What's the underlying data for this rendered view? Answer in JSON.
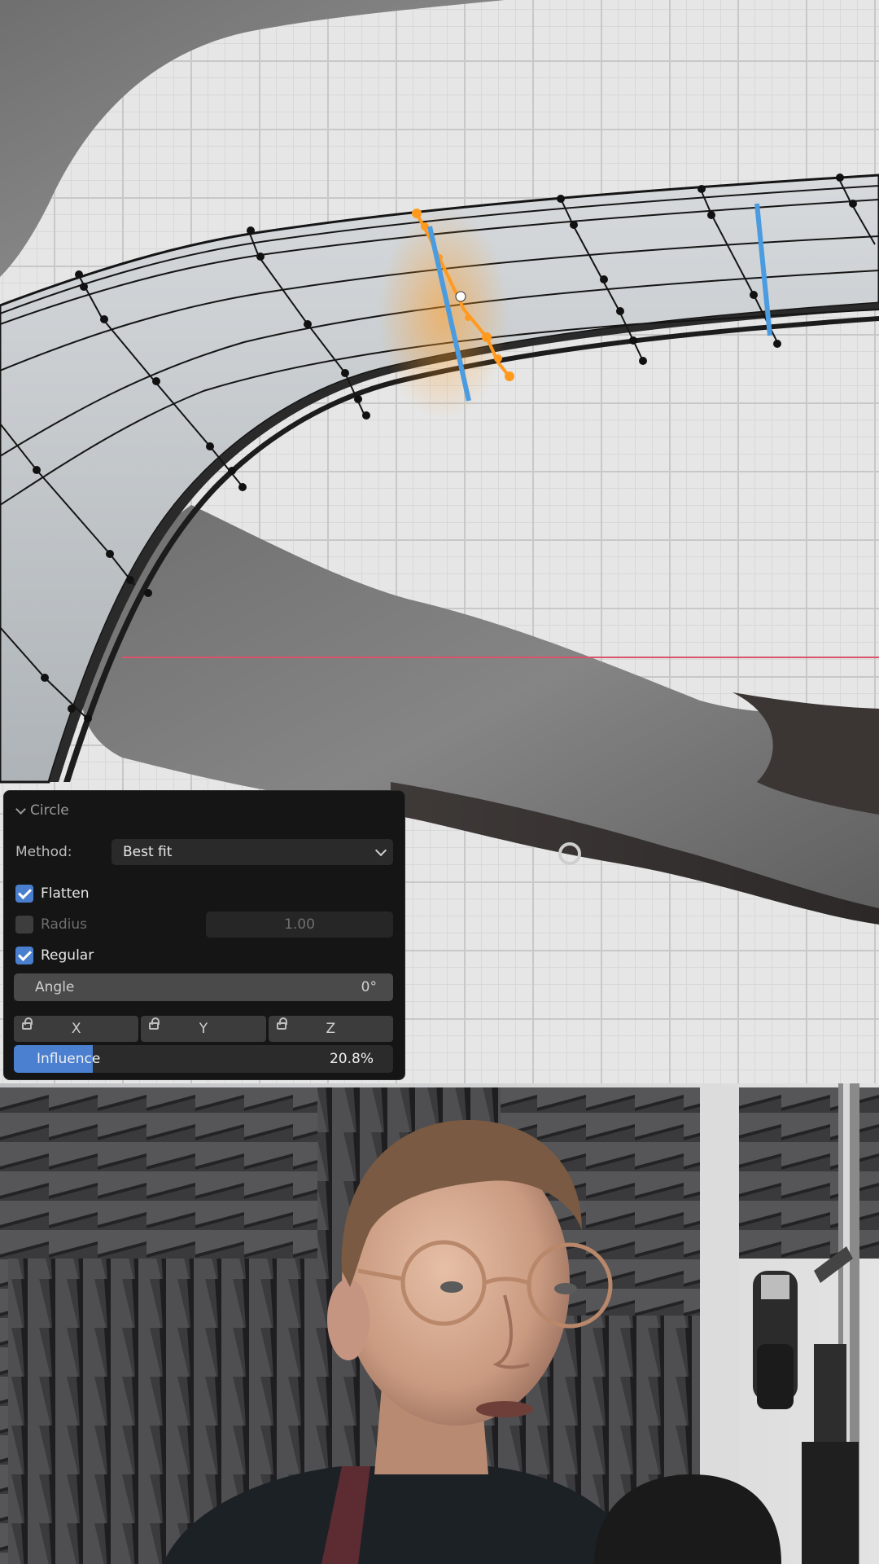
{
  "panel": {
    "title": "Circle",
    "method_label": "Method:",
    "method_value": "Best fit",
    "flatten": {
      "label": "Flatten",
      "checked": true
    },
    "radius": {
      "label": "Radius",
      "value": "1.00",
      "checked": false
    },
    "regular": {
      "label": "Regular",
      "checked": true
    },
    "angle": {
      "label": "Angle",
      "value": "0°"
    },
    "axes": [
      "X",
      "Y",
      "Z"
    ],
    "influence": {
      "label": "Influence",
      "value": "20.8%",
      "fraction": 0.208
    }
  },
  "colors": {
    "accent": "#4b7fd0",
    "selection": "#ff9a1f",
    "edge_highlight": "#4a9be0"
  }
}
